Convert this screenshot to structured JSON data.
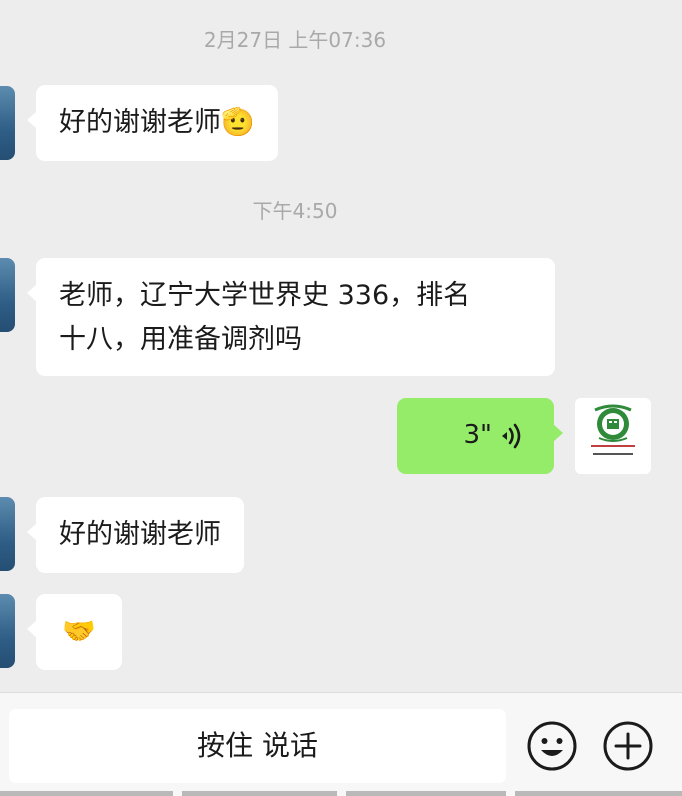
{
  "chat": {
    "timestamp_1": "2月27日 上午07:36",
    "msg_1": "好的谢谢老师🫡",
    "timestamp_2": "下午4:50",
    "msg_2_line_1": "老师，辽宁大学世界史 336，排名",
    "msg_2_line_2": "十八，用准备调剂吗",
    "voice_duration": "3\"",
    "msg_3": "好的谢谢老师",
    "msg_4": "🤝"
  },
  "input_bar": {
    "hold_to_talk_label": "按住 说话",
    "emoji_icon": "smiley-face-icon",
    "plus_icon": "plus-circle-icon"
  },
  "colors": {
    "background": "#ededed",
    "incoming_bubble": "#ffffff",
    "outgoing_bubble": "#95ec69",
    "timestamp_text": "#a9a9a9"
  }
}
